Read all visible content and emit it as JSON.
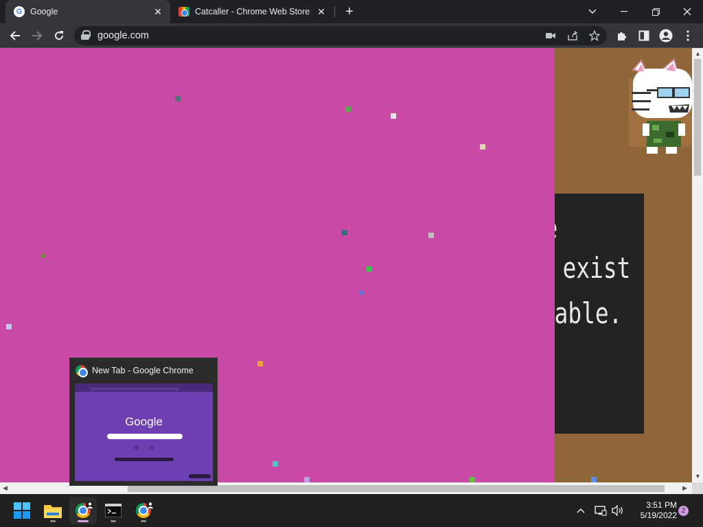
{
  "tabs": [
    {
      "title": "Google",
      "icon": "google-g-icon",
      "active": true
    },
    {
      "title": "Catcaller - Chrome Web Store",
      "icon": "chrome-web-store-icon",
      "active": false
    }
  ],
  "toolbar": {
    "url": "google.com"
  },
  "page": {
    "background_color": "#c949a4",
    "side_panel_color": "#8f6638",
    "error_lines": [
      "e",
      "ot exist",
      "ailable."
    ]
  },
  "preview": {
    "title": "New Tab - Google Chrome",
    "logo_text": "Google"
  },
  "taskbar": {
    "time": "3:51 PM",
    "date": "5/19/2022",
    "notification_count": "2"
  }
}
